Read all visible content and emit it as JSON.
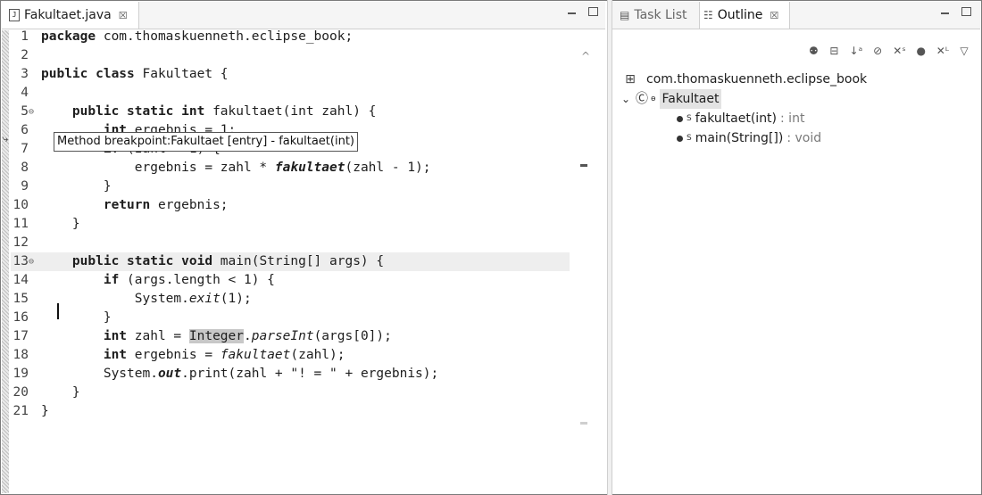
{
  "editor": {
    "tab_label": "Fakultaet.java",
    "tab_close": "☒",
    "tooltip": "Method breakpoint:Fakultaet [entry] - fakultaet(int)"
  },
  "code": {
    "lines": [
      {
        "n": "1",
        "segs": [
          [
            "kw",
            "package"
          ],
          [
            "",
            "com.thomaskuenneth.eclipse_book;"
          ]
        ]
      },
      {
        "n": "2",
        "segs": []
      },
      {
        "n": "3",
        "segs": [
          [
            "kw",
            "public class"
          ],
          [
            "",
            "Fakultaet {"
          ]
        ]
      },
      {
        "n": "4",
        "segs": []
      },
      {
        "n": "5",
        "fold": true,
        "segs": [
          [
            "",
            "    "
          ],
          [
            "kw",
            "public static int"
          ],
          [
            "",
            "fakultaet(int zahl) {"
          ]
        ]
      },
      {
        "n": "6",
        "segs": [
          [
            "",
            "        "
          ],
          [
            "kw",
            "int"
          ],
          [
            "",
            " ergebnis = 1;"
          ]
        ]
      },
      {
        "n": "7",
        "segs": [
          [
            "",
            "        "
          ],
          [
            "kw",
            "if"
          ],
          [
            "",
            " (zahl > 1) {"
          ]
        ]
      },
      {
        "n": "8",
        "segs": [
          [
            "",
            "            ergebnis = zahl * "
          ],
          [
            "itb",
            "fakultaet"
          ],
          [
            "",
            "(zahl - 1);"
          ]
        ]
      },
      {
        "n": "9",
        "segs": [
          [
            "",
            "        }"
          ]
        ]
      },
      {
        "n": "10",
        "segs": [
          [
            "",
            "        "
          ],
          [
            "kw",
            "return"
          ],
          [
            "",
            " ergebnis;"
          ]
        ]
      },
      {
        "n": "11",
        "segs": [
          [
            "",
            "    }"
          ]
        ]
      },
      {
        "n": "12",
        "segs": []
      },
      {
        "n": "13",
        "fold": true,
        "hl": true,
        "segs": [
          [
            "",
            "    "
          ],
          [
            "kw",
            "public static void"
          ],
          [
            "",
            " main(String[] args) {"
          ]
        ]
      },
      {
        "n": "14",
        "segs": [
          [
            "",
            "        "
          ],
          [
            "kw",
            "if"
          ],
          [
            "",
            " (args.length < 1) {"
          ]
        ]
      },
      {
        "n": "15",
        "segs": [
          [
            "",
            "            System."
          ],
          [
            "it",
            "exit"
          ],
          [
            "",
            "(1);"
          ]
        ]
      },
      {
        "n": "16",
        "segs": [
          [
            "",
            "        }"
          ]
        ]
      },
      {
        "n": "17",
        "segs": [
          [
            "",
            "        "
          ],
          [
            "kw",
            "int"
          ],
          [
            "",
            " zahl = "
          ],
          [
            "occ",
            "Integer"
          ],
          [
            "",
            "."
          ],
          [
            "it",
            "parseInt"
          ],
          [
            "",
            "(args[0]);"
          ]
        ]
      },
      {
        "n": "18",
        "segs": [
          [
            "",
            "        "
          ],
          [
            "kw",
            "int"
          ],
          [
            "",
            " ergebnis = "
          ],
          [
            "it",
            "fakultaet"
          ],
          [
            "",
            "(zahl);"
          ]
        ]
      },
      {
        "n": "19",
        "segs": [
          [
            "",
            "        System."
          ],
          [
            "itb",
            "out"
          ],
          [
            "",
            ".print(zahl + \"! = \" + ergebnis);"
          ]
        ]
      },
      {
        "n": "20",
        "segs": [
          [
            "",
            "    }"
          ]
        ]
      },
      {
        "n": "21",
        "segs": [
          [
            "",
            "}"
          ]
        ]
      }
    ]
  },
  "outline_panel": {
    "tab_tasks": "Task List",
    "tab_outline": "Outline",
    "tab_close": "☒",
    "toolbar_icons": [
      "show-inherited-icon",
      "collapse-all-icon",
      "sort-icon",
      "hide-fields-icon",
      "hide-static-icon",
      "hide-non-public-icon",
      "hide-local-types-icon",
      "view-menu-icon"
    ],
    "package_name": "com.thomaskuenneth.eclipse_book",
    "class_name": "Fakultaet",
    "methods": [
      {
        "name": "fakultaet(int)",
        "type": ": int"
      },
      {
        "name": "main(String[])",
        "type": ": void"
      }
    ]
  }
}
